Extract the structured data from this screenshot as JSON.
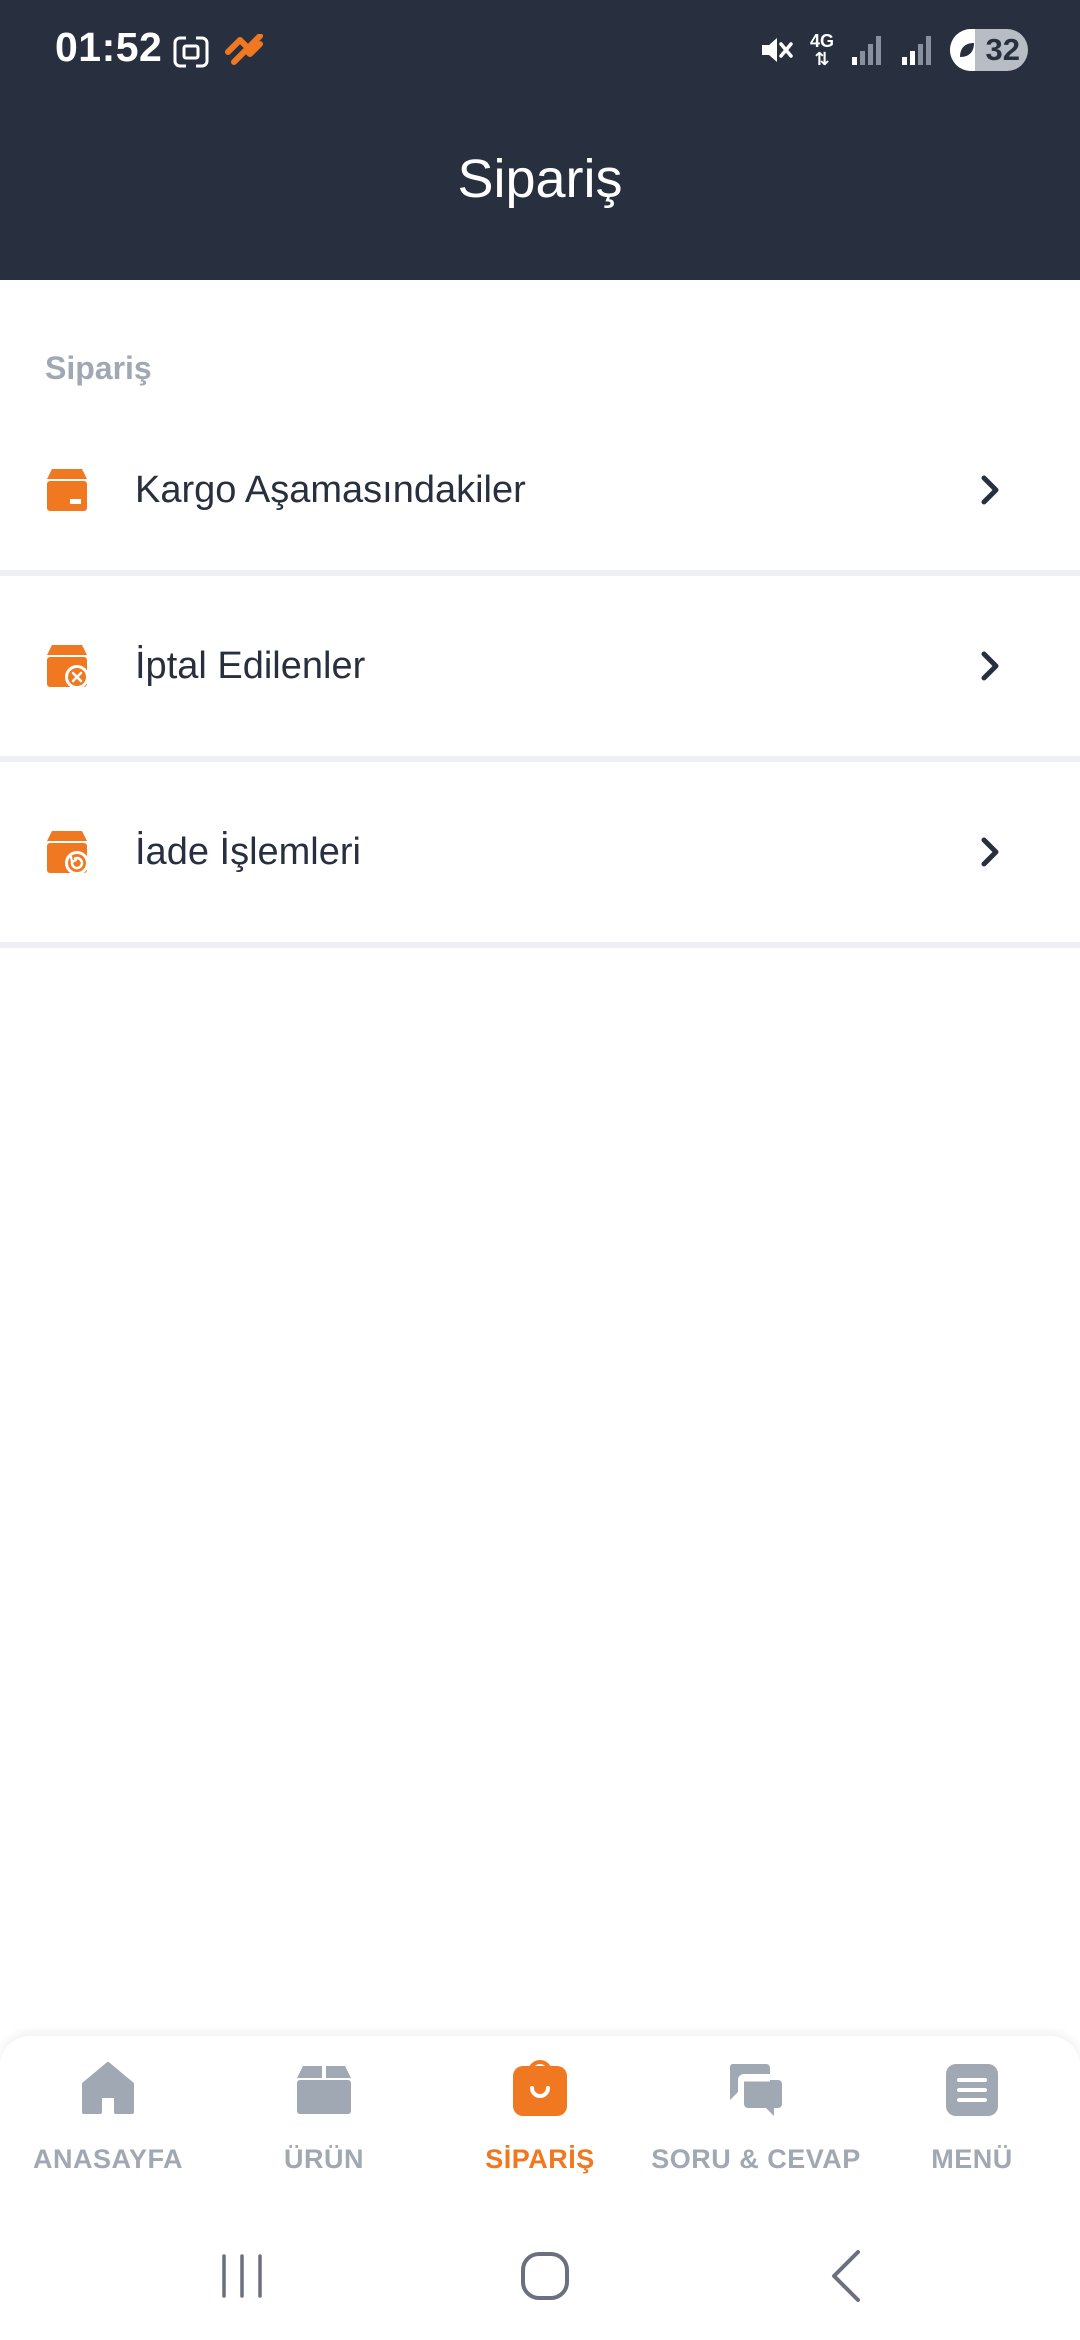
{
  "status_bar": {
    "time": "01:52",
    "battery": "32",
    "network": "4G"
  },
  "header": {
    "title": "Sipariş"
  },
  "section": {
    "title": "Sipariş"
  },
  "menu_items": [
    {
      "label": "Kargo Aşamasındakiler",
      "icon": "package-icon"
    },
    {
      "label": "İptal Edilenler",
      "icon": "package-cancel-icon"
    },
    {
      "label": "İade İşlemleri",
      "icon": "package-return-icon"
    }
  ],
  "bottom_nav": [
    {
      "label": "ANASAYFA",
      "icon": "home-icon",
      "active": false
    },
    {
      "label": "ÜRÜN",
      "icon": "box-icon",
      "active": false
    },
    {
      "label": "SİPARİŞ",
      "icon": "shopping-bag-icon",
      "active": true
    },
    {
      "label": "SORU & CEVAP",
      "icon": "chat-bubbles-icon",
      "active": false
    },
    {
      "label": "MENÜ",
      "icon": "menu-icon",
      "active": false
    }
  ],
  "colors": {
    "header_bg": "#283040",
    "accent": "#f07820",
    "inactive": "#a0a8b4",
    "text": "#283040",
    "divider": "#eef0f4"
  }
}
